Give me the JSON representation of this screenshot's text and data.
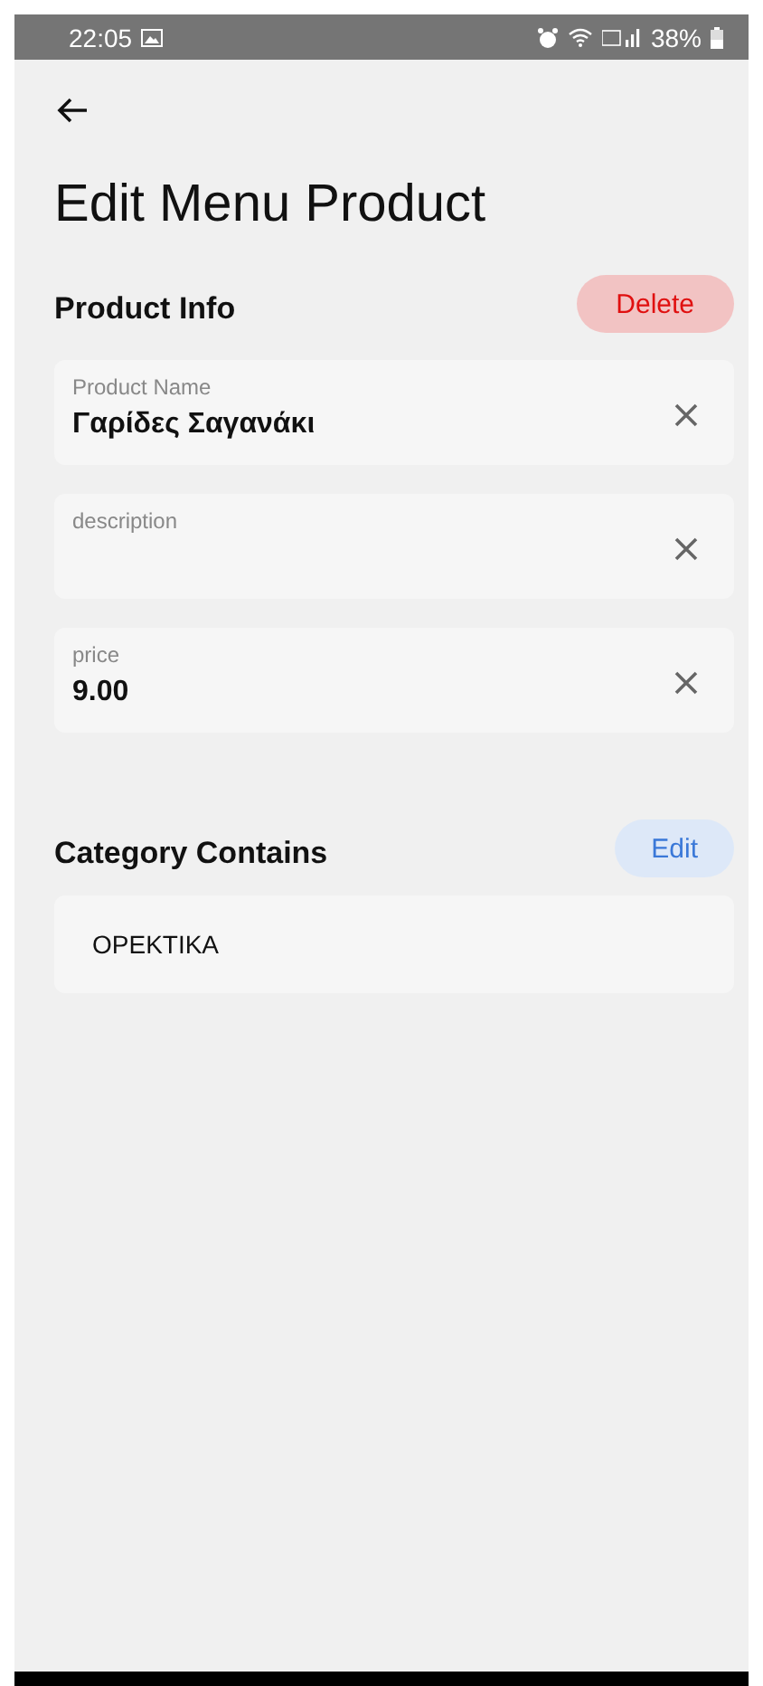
{
  "status_bar": {
    "time": "22:05",
    "battery": "38%"
  },
  "title": "Edit Menu Product",
  "product_info": {
    "heading": "Product Info",
    "delete_button": "Delete",
    "fields": [
      {
        "label": "Product Name",
        "value": "Γαρίδες Σαγανάκι"
      },
      {
        "label": "description"
      },
      {
        "label": "price",
        "value": "9.00"
      }
    ]
  },
  "category": {
    "heading": "Category Contains",
    "edit_button": "Edit",
    "items": [
      "ΟΡΕΚΤΙΚΑ"
    ]
  }
}
